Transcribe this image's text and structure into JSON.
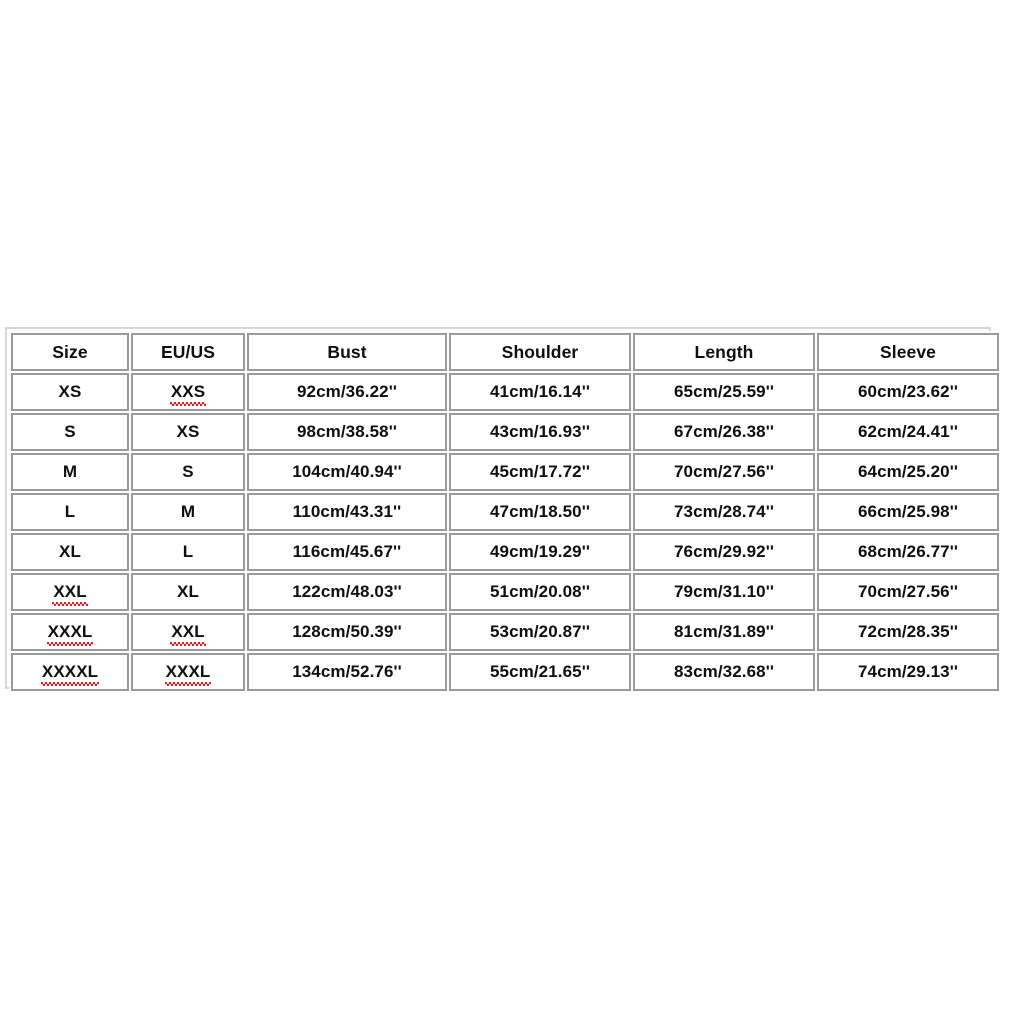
{
  "chart_data": {
    "type": "table",
    "title": "",
    "columns": [
      "Size",
      "EU/US",
      "Bust",
      "Shoulder",
      "Length",
      "Sleeve"
    ],
    "rows": [
      {
        "size": "XS",
        "size_misspelled": false,
        "euus": "XXS",
        "euus_misspelled": true,
        "bust": "92cm/36.22''",
        "shoulder": "41cm/16.14''",
        "length": "65cm/25.59''",
        "sleeve": "60cm/23.62''"
      },
      {
        "size": "S",
        "size_misspelled": false,
        "euus": "XS",
        "euus_misspelled": false,
        "bust": "98cm/38.58''",
        "shoulder": "43cm/16.93''",
        "length": "67cm/26.38''",
        "sleeve": "62cm/24.41''"
      },
      {
        "size": "M",
        "size_misspelled": false,
        "euus": "S",
        "euus_misspelled": false,
        "bust": "104cm/40.94''",
        "shoulder": "45cm/17.72''",
        "length": "70cm/27.56''",
        "sleeve": "64cm/25.20''"
      },
      {
        "size": "L",
        "size_misspelled": false,
        "euus": "M",
        "euus_misspelled": false,
        "bust": "110cm/43.31''",
        "shoulder": "47cm/18.50''",
        "length": "73cm/28.74''",
        "sleeve": "66cm/25.98''"
      },
      {
        "size": "XL",
        "size_misspelled": false,
        "euus": "L",
        "euus_misspelled": false,
        "bust": "116cm/45.67''",
        "shoulder": "49cm/19.29''",
        "length": "76cm/29.92''",
        "sleeve": "68cm/26.77''"
      },
      {
        "size": "XXL",
        "size_misspelled": true,
        "euus": "XL",
        "euus_misspelled": false,
        "bust": "122cm/48.03''",
        "shoulder": "51cm/20.08''",
        "length": "79cm/31.10''",
        "sleeve": "70cm/27.56''"
      },
      {
        "size": "XXXL",
        "size_misspelled": true,
        "euus": "XXL",
        "euus_misspelled": true,
        "bust": "128cm/50.39''",
        "shoulder": "53cm/20.87''",
        "length": "81cm/31.89''",
        "sleeve": "72cm/28.35''"
      },
      {
        "size": "XXXXL",
        "size_misspelled": true,
        "euus": "XXXL",
        "euus_misspelled": true,
        "bust": "134cm/52.76''",
        "shoulder": "55cm/21.65''",
        "length": "83cm/32.68''",
        "sleeve": "74cm/29.13''"
      }
    ],
    "units_note": "Measurements shown in centimeters and inches",
    "colors": {
      "text": "#100f0f",
      "cell_border": "#9a9a9a",
      "outer_border": "#d8d8d8",
      "background": "#ffffff",
      "spellcheck_underline": "#e02020"
    }
  }
}
